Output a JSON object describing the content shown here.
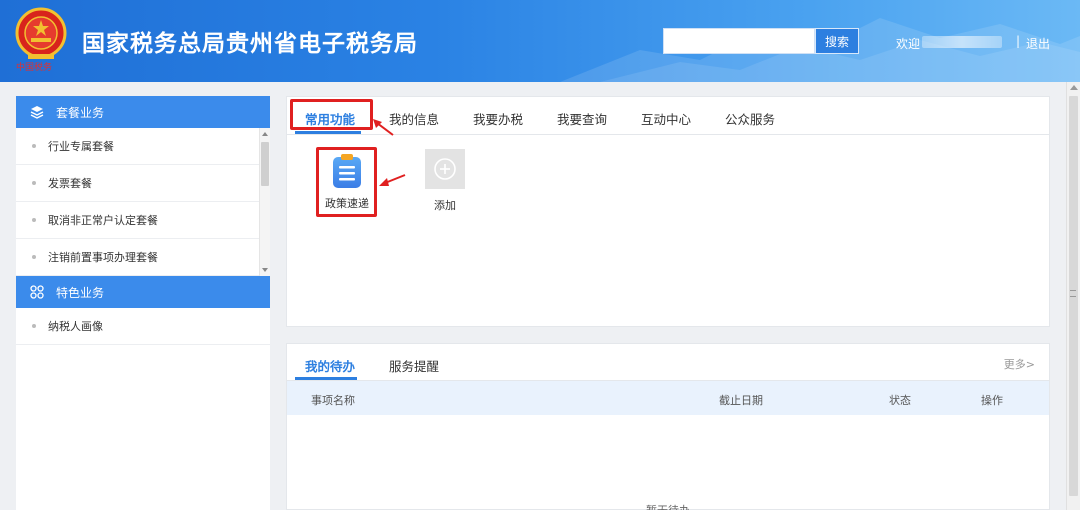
{
  "header": {
    "title": "国家税务总局贵州省电子税务局",
    "emblem_caption": "中国税务",
    "search_placeholder": "",
    "search_button": "搜索",
    "welcome": "欢迎",
    "separator": "|",
    "logout": "退出"
  },
  "sidebar": {
    "sections": [
      {
        "title": "套餐业务",
        "icon": "layers-icon",
        "items": [
          "行业专属套餐",
          "发票套餐",
          "取消非正常户认定套餐",
          "注销前置事项办理套餐"
        ]
      },
      {
        "title": "特色业务",
        "icon": "grid-icon",
        "items": [
          "纳税人画像"
        ]
      }
    ]
  },
  "functions": {
    "tabs": [
      "常用功能",
      "我的信息",
      "我要办税",
      "我要查询",
      "互动中心",
      "公众服务"
    ],
    "active_tab": "常用功能",
    "tiles": [
      {
        "label": "政策速递",
        "icon": "document-list-icon"
      },
      {
        "label": "添加",
        "icon": "plus-circle-icon"
      }
    ]
  },
  "todo": {
    "tabs": [
      "我的待办",
      "服务提醒"
    ],
    "active_tab": "我的待办",
    "more": "更多>",
    "columns": [
      "事项名称",
      "截止日期",
      "状态",
      "操作"
    ],
    "empty_text": "暂无待办"
  },
  "colors": {
    "primary": "#2d7fe0",
    "sidebar_header": "#3b8beb",
    "highlight_red": "#e02020",
    "table_header_bg": "#e9f2fd"
  }
}
